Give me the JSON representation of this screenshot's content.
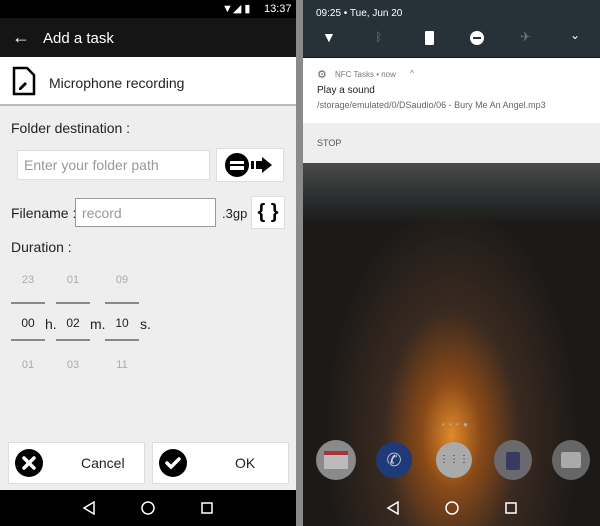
{
  "left": {
    "status_bar": {
      "time": "13:37"
    },
    "toolbar": {
      "title": "Add a task"
    },
    "task": {
      "name": "Microphone recording"
    },
    "folder": {
      "label": "Folder destination :",
      "placeholder": "Enter your folder path"
    },
    "filename": {
      "label": "Filename :",
      "placeholder": "record",
      "extension": ".3gp"
    },
    "duration": {
      "label": "Duration :",
      "hours": {
        "prev": "23",
        "value": "00",
        "next": "01",
        "unit": "h."
      },
      "minutes": {
        "prev": "01",
        "value": "02",
        "next": "03",
        "unit": "m."
      },
      "seconds": {
        "prev": "09",
        "value": "10",
        "next": "11",
        "unit": "s."
      }
    },
    "buttons": {
      "cancel": "Cancel",
      "ok": "OK"
    }
  },
  "right": {
    "status": {
      "datetime": "09:25 • Tue, Jun 20"
    },
    "notification": {
      "app": "NFC Tasks • now",
      "title": "Play a sound",
      "text": "/storage/emulated/0/DSaudio/06 - Bury Me An Angel.mp3",
      "action": "STOP"
    },
    "dock": [
      "gmail",
      "phone",
      "apps",
      "lock-app",
      "camera"
    ]
  }
}
